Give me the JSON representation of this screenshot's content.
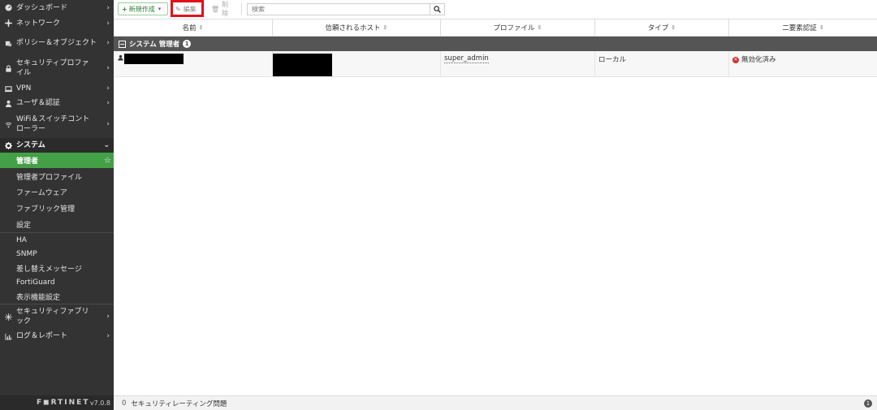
{
  "sidebar": {
    "items": [
      {
        "label": "ダッシュボード",
        "icon": "dashboard-icon"
      },
      {
        "label": "ネットワーク",
        "icon": "network-icon"
      },
      {
        "label": "ポリシー＆オブジェクト",
        "icon": "policy-icon"
      },
      {
        "label": "セキュリティプロファイル",
        "icon": "lock-icon"
      },
      {
        "label": "VPN",
        "icon": "vpn-icon"
      },
      {
        "label": "ユーザ＆認証",
        "icon": "user-icon"
      },
      {
        "label": "WiFi＆スイッチコントローラー",
        "icon": "wifi-icon"
      },
      {
        "label": "システム",
        "icon": "gear-icon"
      }
    ],
    "system_sub": [
      {
        "label": "管理者"
      },
      {
        "label": "管理者プロファイル"
      },
      {
        "label": "ファームウェア"
      },
      {
        "label": "ファブリック管理"
      },
      {
        "label": "設定"
      }
    ],
    "system_sub2": [
      {
        "label": "HA"
      },
      {
        "label": "SNMP"
      },
      {
        "label": "差し替えメッセージ"
      },
      {
        "label": "FortiGuard"
      },
      {
        "label": "表示機能設定"
      }
    ],
    "bottom_items": [
      {
        "label": "セキュリティファブリック",
        "icon": "fabric-icon"
      },
      {
        "label": "ログ＆レポート",
        "icon": "chart-icon"
      }
    ],
    "logo": "F◼RTINET",
    "version": "v7.0.8"
  },
  "toolbar": {
    "new_label": "新規作成",
    "edit_label": "編集",
    "delete_label": "削除",
    "search_placeholder": "検索"
  },
  "table": {
    "columns": [
      "名前",
      "信頼されるホスト",
      "プロファイル",
      "タイプ",
      "二要素認証"
    ],
    "group": {
      "label": "システム 管理者",
      "count": "1"
    },
    "rows": [
      {
        "name": "",
        "hosts": "",
        "profile": "super_admin",
        "type": "ローカル",
        "two_factor": "無効化済み"
      }
    ]
  },
  "bottombar": {
    "count": "0",
    "label": "セキュリティレーティング問題",
    "badge": "1"
  },
  "colors": {
    "sidebar_bg": "#333333",
    "selected_green": "#43a047",
    "highlight_red": "#e0111a",
    "group_header": "#555555"
  }
}
